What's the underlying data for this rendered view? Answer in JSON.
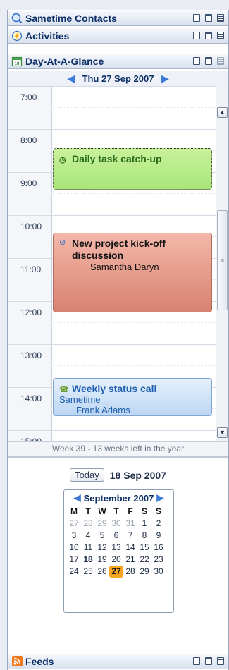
{
  "panels": {
    "sametime": {
      "title": "Sametime Contacts",
      "icon": "sametime-icon"
    },
    "activities": {
      "title": "Activities",
      "icon": "activities-icon"
    },
    "dayglance": {
      "title": "Day-At-A-Glance",
      "icon": "calendar-icon",
      "date_nav": "Thu 27 Sep 2007"
    },
    "feeds": {
      "title": "Feeds",
      "icon": "rss-icon"
    }
  },
  "hours": [
    "7:00",
    "8:00",
    "9:00",
    "10:00",
    "11:00",
    "12:00",
    "13:00",
    "14:00",
    "15:00"
  ],
  "events": [
    {
      "title": "Daily task catch-up",
      "icon": "clock-icon"
    },
    {
      "title": "New project kick-off discussion",
      "subtitle": "Samantha Daryn",
      "icon": "meeting-icon"
    },
    {
      "title": "Weekly status call",
      "line2": "Sametime",
      "line3": "Frank Adams",
      "icon": "call-icon"
    }
  ],
  "week_info": "Week 39 - 13 weeks left in the year",
  "today": {
    "button": "Today",
    "date": "18 Sep 2007"
  },
  "mini_calendar": {
    "month": "September 2007",
    "day_names": [
      "M",
      "T",
      "W",
      "T",
      "F",
      "S",
      "S"
    ],
    "days": [
      [
        "27",
        "28",
        "29",
        "30",
        "31",
        "1",
        "2"
      ],
      [
        "3",
        "4",
        "5",
        "6",
        "7",
        "8",
        "9"
      ],
      [
        "10",
        "11",
        "12",
        "13",
        "14",
        "15",
        "16"
      ],
      [
        "17",
        "18",
        "19",
        "20",
        "21",
        "22",
        "23"
      ],
      [
        "24",
        "25",
        "26",
        "27",
        "28",
        "29",
        "30"
      ]
    ],
    "selected": "27",
    "today": "18"
  },
  "colors": {
    "event_green": "#c9f19a",
    "event_red": "#e48f7d",
    "event_blue": "#cfe3f7",
    "selected_day": "#f6a623"
  }
}
